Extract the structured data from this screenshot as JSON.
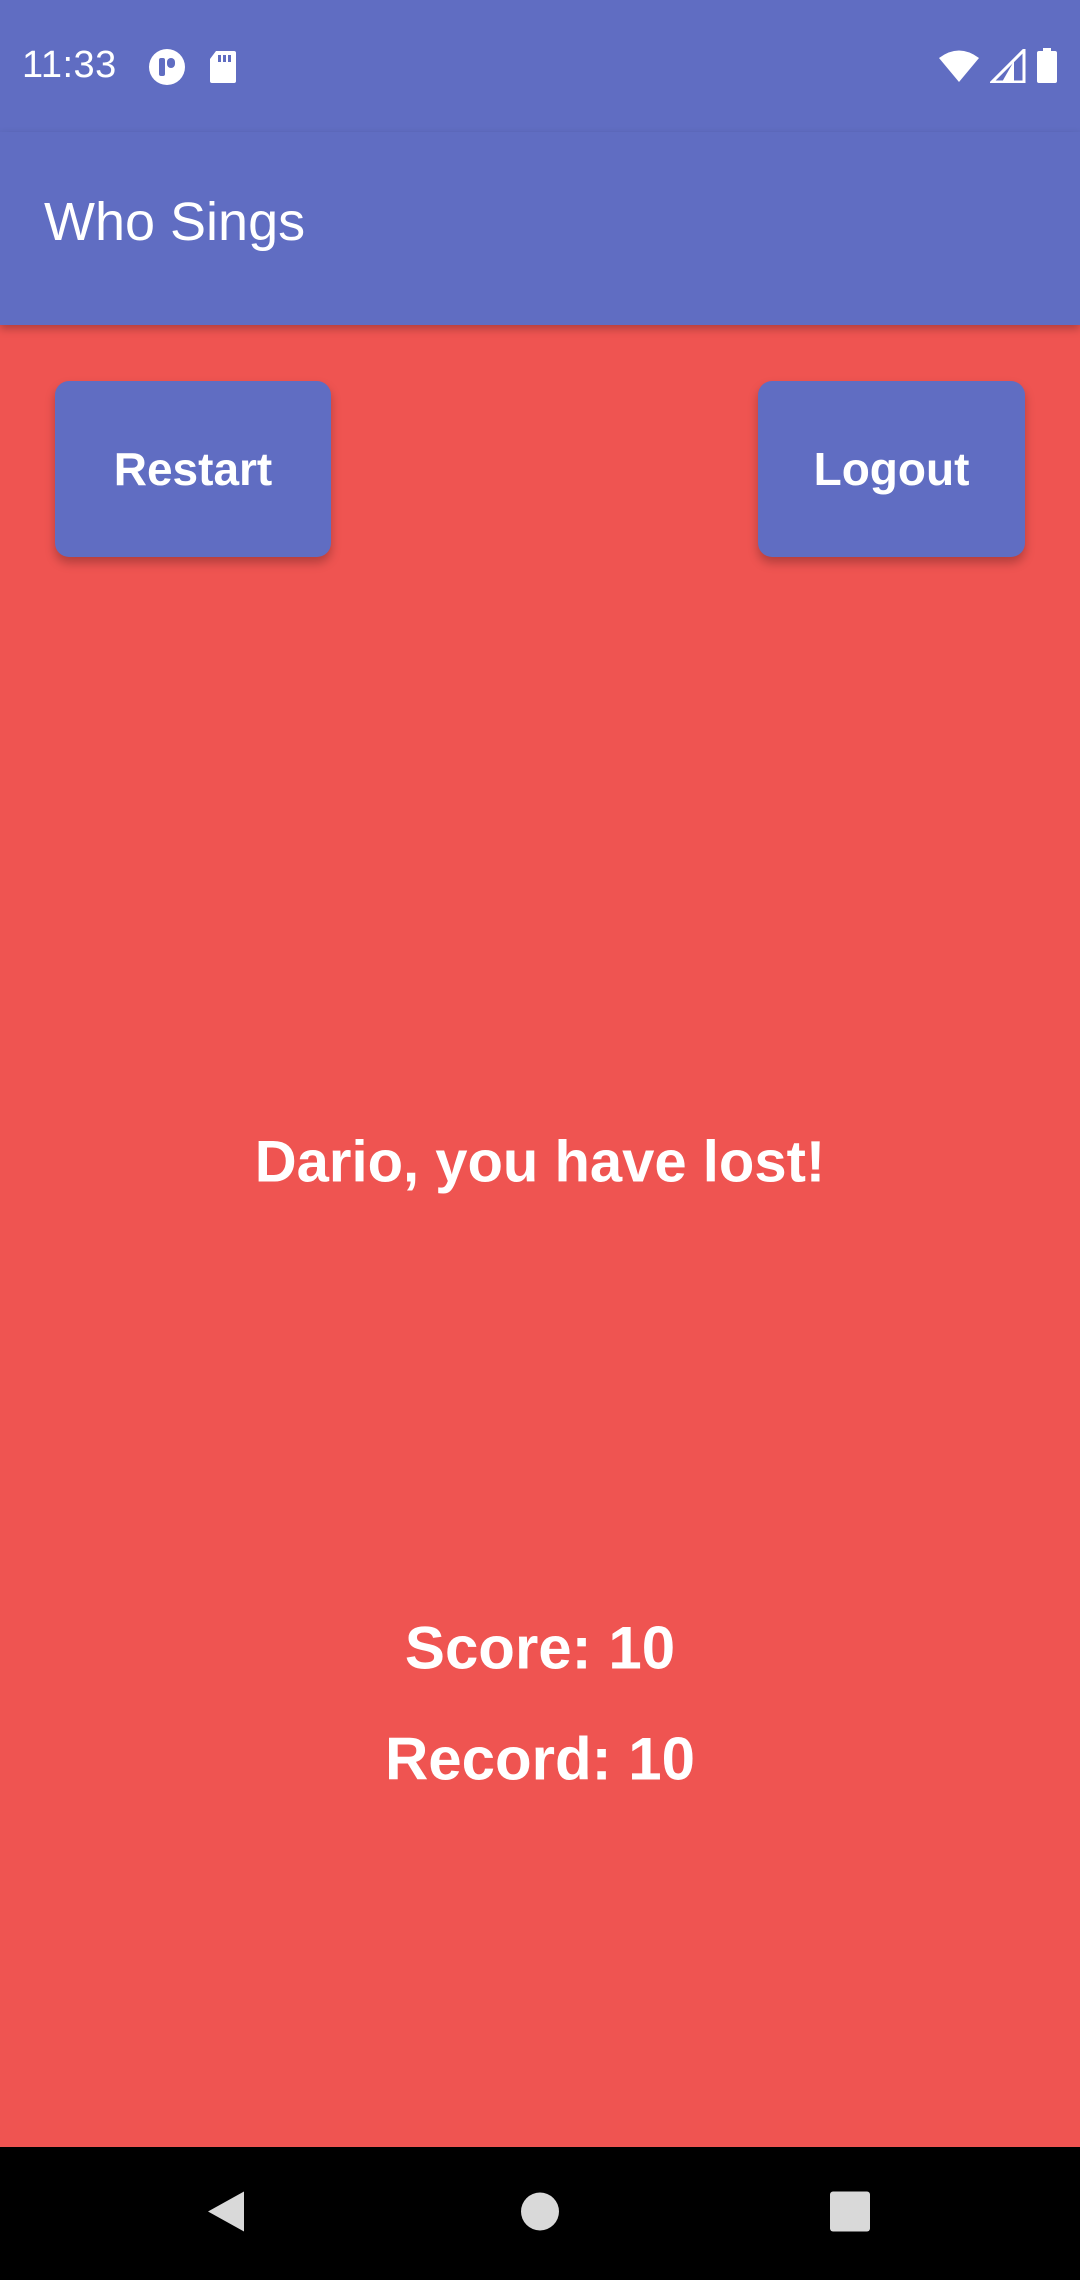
{
  "status_bar": {
    "time": "11:33",
    "icons": [
      "circle-badge-icon",
      "sd-card-icon",
      "wifi-icon",
      "cell-signal-icon",
      "battery-icon"
    ]
  },
  "app_bar": {
    "title": "Who Sings"
  },
  "actions": {
    "restart_label": "Restart",
    "logout_label": "Logout"
  },
  "result": {
    "message": "Dario, you have lost!",
    "score_text": "Score: 10",
    "record_text": "Record: 10"
  },
  "nav_bar": {
    "icons": [
      "back-icon",
      "home-icon",
      "recents-icon"
    ]
  },
  "colors": {
    "primary": "#606dc2",
    "background": "#ef5451",
    "text": "#ffffff",
    "nav": "#000000"
  }
}
